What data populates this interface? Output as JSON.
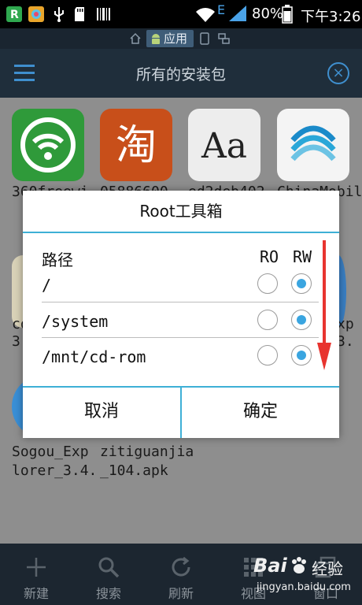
{
  "status_bar": {
    "network_letter": "E",
    "battery": "80%",
    "time": "下午3:26"
  },
  "mode_bar": {
    "active_label": "应用"
  },
  "header": {
    "title": "所有的安装包"
  },
  "apps": [
    {
      "label_line1": "360freewi",
      "label_line2": ""
    },
    {
      "label_line1": "05886600",
      "label_line2": ""
    },
    {
      "label_line1": "ed2deb402",
      "label_line2": ""
    },
    {
      "label_line1": "ChinaMobil",
      "label_line2": ""
    },
    {
      "label_line1": "co",
      "label_line2": "3"
    },
    {
      "label_line1": "xp",
      "label_line2": "3."
    },
    {
      "label_line1": "Sogou_Exp",
      "label_line2": "lorer_3.4."
    },
    {
      "label_line1": "zitiguanjia",
      "label_line2": "_104.apk"
    }
  ],
  "dialog": {
    "title": "Root工具箱",
    "column_path": "路径",
    "column_ro": "RO",
    "column_rw": "RW",
    "rows": [
      {
        "path": "/",
        "ro": false,
        "rw": true
      },
      {
        "path": "/system",
        "ro": false,
        "rw": true
      },
      {
        "path": "/mnt/cd-rom",
        "ro": false,
        "rw": true
      }
    ],
    "cancel_label": "取消",
    "confirm_label": "确定"
  },
  "bottom_bar": {
    "items": [
      {
        "label": "新建",
        "icon": "plus-icon"
      },
      {
        "label": "搜索",
        "icon": "search-icon"
      },
      {
        "label": "刷新",
        "icon": "refresh-icon"
      },
      {
        "label": "视图",
        "icon": "grid-icon"
      },
      {
        "label": "窗口",
        "icon": "windows-icon"
      }
    ]
  },
  "watermark": {
    "brand": "Bai",
    "brand_suffix": "经验",
    "url": "jingyan.baidu.com"
  },
  "colors": {
    "accent": "#3eb0d6",
    "radio_selected": "#3aa5e0",
    "header_bg": "#1f2e3b",
    "arrow": "#e8342f"
  }
}
